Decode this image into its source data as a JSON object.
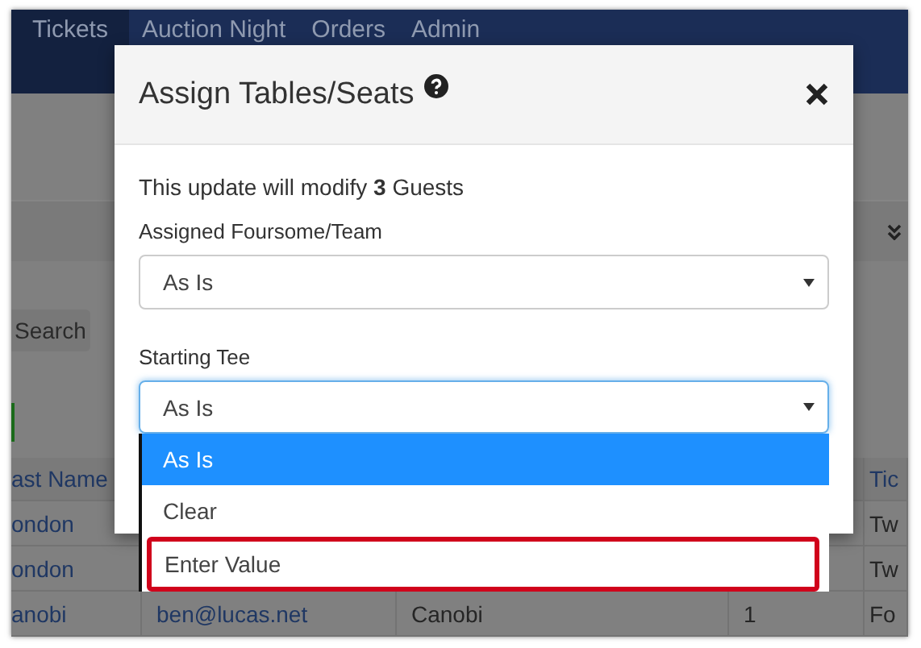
{
  "nav": {
    "items": [
      {
        "label": "Tickets",
        "selected": true
      },
      {
        "label": "Auction Night",
        "selected": false
      },
      {
        "label": "Orders",
        "selected": false
      },
      {
        "label": "Admin",
        "selected": false
      }
    ]
  },
  "search_button": "Search",
  "table": {
    "header": {
      "column_1": "ast Name",
      "column_5": "Tic"
    },
    "rows": [
      {
        "column_1": "ondon",
        "column_5": "Tw"
      },
      {
        "column_1": "ondon",
        "column_5": "Tw"
      },
      {
        "column_1": "anobi",
        "column_2": "ben@lucas.net",
        "column_3": "Canobi",
        "column_4": "1",
        "column_5": "Fo"
      }
    ]
  },
  "modal": {
    "title": "Assign Tables/Seats",
    "message": "This update will modify **3** Guests",
    "fields": [
      {
        "label": "Assigned Foursome/Team",
        "value": "As Is",
        "focused": false,
        "open": false
      },
      {
        "label": "Starting Tee",
        "value": "As Is",
        "focused": true,
        "open": true
      }
    ],
    "options": [
      {
        "label": "As Is",
        "selected": true,
        "highlighted": false
      },
      {
        "label": "Clear",
        "selected": false,
        "highlighted": false
      },
      {
        "label": "Enter Value",
        "selected": false,
        "highlighted": true
      }
    ]
  }
}
